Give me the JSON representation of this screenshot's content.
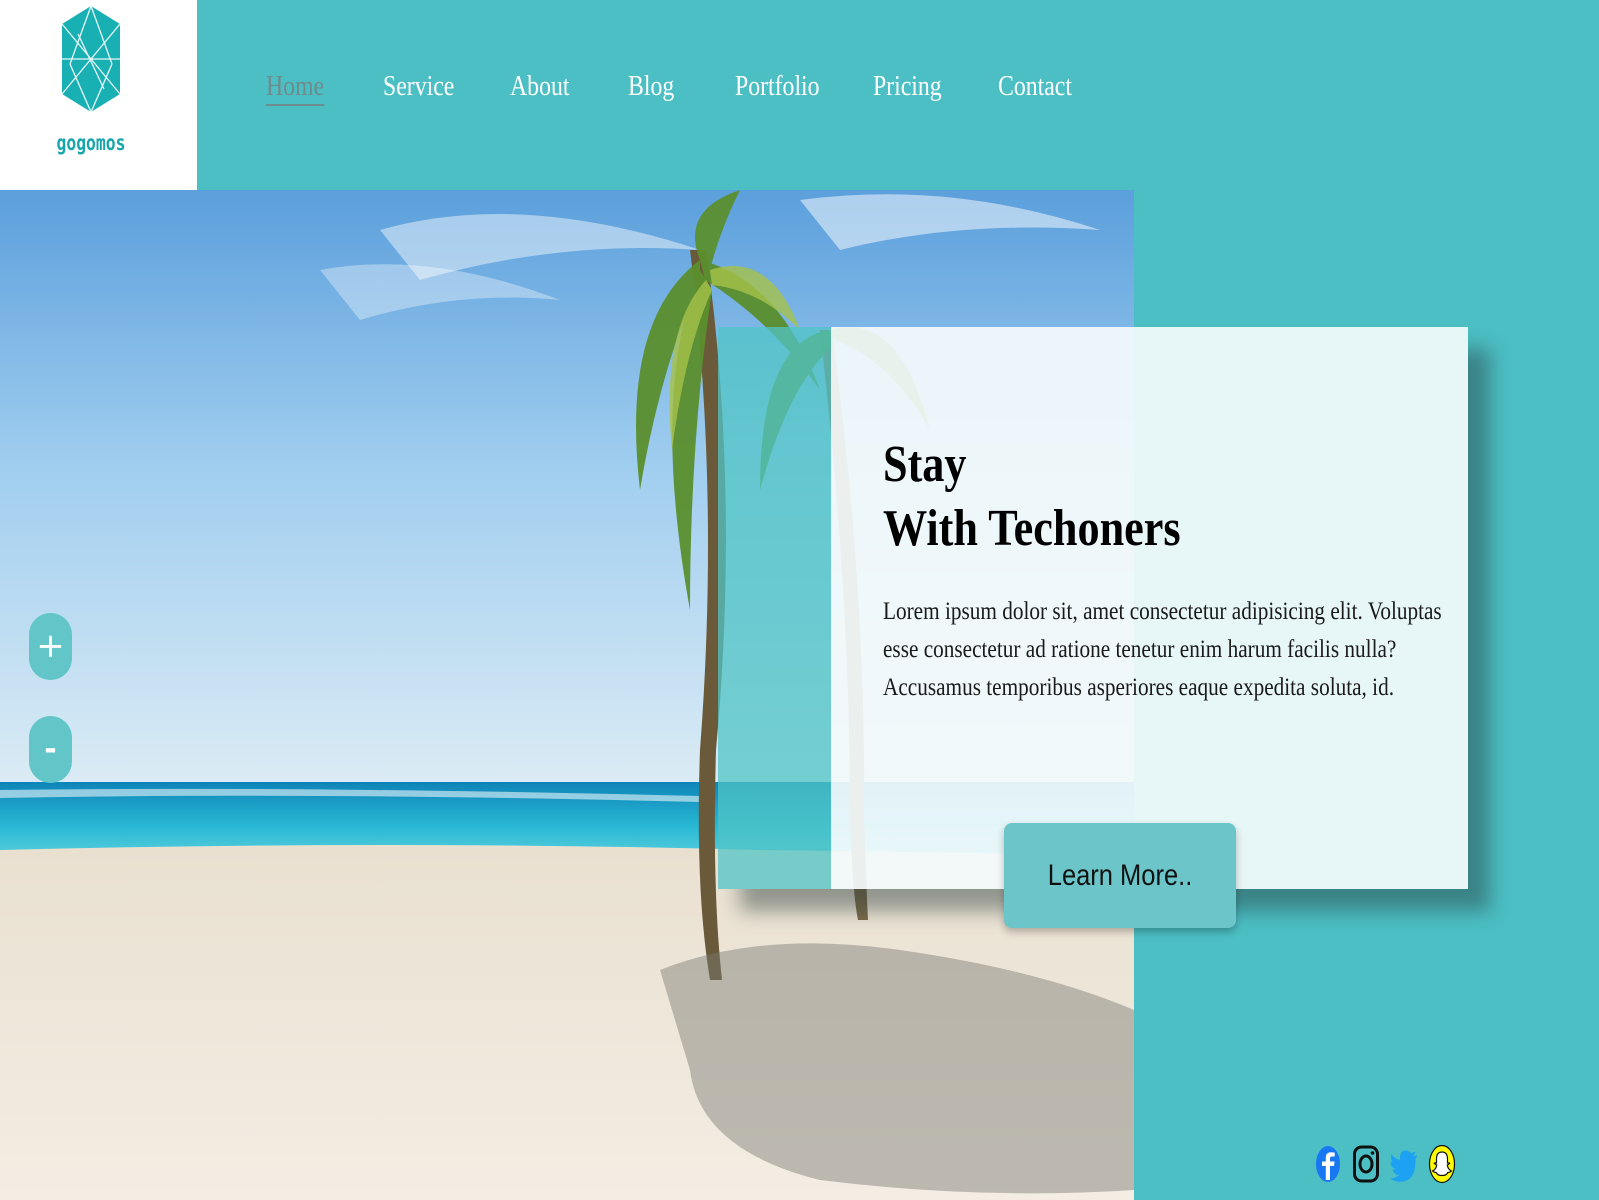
{
  "logo": {
    "icon": "hexagon-gem-icon",
    "text": "gogomos",
    "color": "#18a6ad"
  },
  "nav": {
    "items": [
      {
        "label": "Home",
        "active": true
      },
      {
        "label": "Service",
        "active": false
      },
      {
        "label": "About",
        "active": false
      },
      {
        "label": "Blog",
        "active": false
      },
      {
        "label": "Portfolio",
        "active": false
      },
      {
        "label": "Pricing",
        "active": false
      },
      {
        "label": "Contact",
        "active": false
      }
    ]
  },
  "hero": {
    "image": "tropical-beach-palm-photo"
  },
  "zoom": {
    "in_label": "+",
    "out_label": "-"
  },
  "card": {
    "title_line1": "Stay",
    "title_line2": "With Techoners",
    "text": "Lorem ipsum dolor sit, amet consectetur adipisicing elit. Voluptas esse consectetur ad ratione tenetur enim harum facilis nulla? Accusamus temporibus asperiores eaque expedita soluta, id.",
    "button_label": "Learn More.."
  },
  "social": {
    "icons": [
      "facebook-icon",
      "instagram-icon",
      "twitter-icon",
      "snapchat-icon"
    ]
  },
  "colors": {
    "background": "#4bbfc4",
    "accent": "#6cc6c9",
    "nav_active": "#6e8c8d",
    "text": "#ffffff"
  }
}
